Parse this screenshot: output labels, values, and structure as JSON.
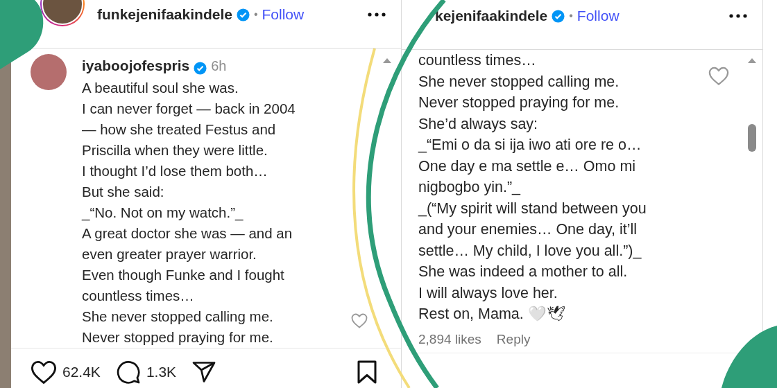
{
  "left_panel": {
    "header": {
      "username": "funkejenifaakindele",
      "verified": true,
      "dot": "•",
      "follow": "Follow"
    },
    "comment": {
      "username": "iyaboojofespris",
      "verified": true,
      "time": "6h",
      "liked": false,
      "lines": [
        "A beautiful soul she was.",
        "I can never forget — back in 2004",
        "— how she treated Festus and",
        "Priscilla when they were little.",
        "I thought I’d lose them both…",
        "But she said:",
        "_“No. Not on my watch.”_",
        "A great doctor she was — and an",
        "even greater prayer warrior.",
        "Even though Funke and I fought",
        "countless times…",
        "She never stopped calling me.",
        "Never stopped praying for me."
      ]
    },
    "actions": {
      "likes": "62.4K",
      "comments": "1.3K",
      "liked": false,
      "saved": false
    }
  },
  "right_panel": {
    "header": {
      "username": "kejenifaakindele",
      "verified": true,
      "dot": "•",
      "follow": "Follow"
    },
    "comment": {
      "liked": false,
      "lines": [
        "countless times…",
        "She never stopped calling me.",
        "Never stopped praying for me.",
        "She’d always say:",
        "_“Emi o da si ija iwo ati ore re o…",
        "One day e ma settle e… Omo mi",
        "nigbogbo yin.”_",
        "_(“My spirit will stand between you",
        "and your enemies… One day, it’ll",
        "settle… My child, I love you all.”)_",
        "She was indeed a mother to all.",
        "I will always love her.",
        "Rest on, Mama. 🤍🕊"
      ],
      "likes": "2,894 likes",
      "reply": "Reply"
    }
  }
}
